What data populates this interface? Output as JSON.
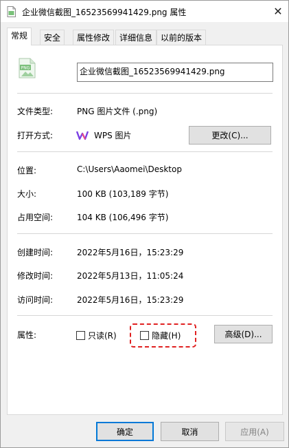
{
  "window": {
    "title": "企业微信截图_16523569941429.png 属性",
    "close_glyph": "✕"
  },
  "tabs": [
    {
      "label": "常规",
      "active": true
    },
    {
      "label": "安全",
      "active": false
    },
    {
      "label": "属性修改",
      "active": false
    },
    {
      "label": "详细信息",
      "active": false
    },
    {
      "label": "以前的版本",
      "active": false
    }
  ],
  "file": {
    "icon_badge": "PNG",
    "name": "企业微信截图_16523569941429.png"
  },
  "type_section": {
    "file_type_label": "文件类型:",
    "file_type_value": "PNG 图片文件 (.png)",
    "open_with_label": "打开方式:",
    "open_with_value": "WPS 图片",
    "change_button": "更改(C)..."
  },
  "location_section": {
    "location_label": "位置:",
    "location_value": "C:\\Users\\Aaomei\\Desktop",
    "size_label": "大小:",
    "size_value": "100 KB (103,189 字节)",
    "disk_size_label": "占用空间:",
    "disk_size_value": "104 KB (106,496 字节)"
  },
  "time_section": {
    "created_label": "创建时间:",
    "created_value": "2022年5月16日，15:23:29",
    "modified_label": "修改时间:",
    "modified_value": "2022年5月13日，11:05:24",
    "accessed_label": "访问时间:",
    "accessed_value": "2022年5月16日，15:23:29"
  },
  "attributes": {
    "label": "属性:",
    "readonly_label": "只读(R)",
    "readonly_checked": false,
    "hidden_label": "隐藏(H)",
    "hidden_checked": false,
    "advanced_button": "高级(D)..."
  },
  "footer": {
    "ok": "确定",
    "cancel": "取消",
    "apply": "应用(A)"
  },
  "colors": {
    "highlight": "#e02020",
    "primary_border": "#0078d7",
    "wps_purple": "#7b3fe4"
  }
}
